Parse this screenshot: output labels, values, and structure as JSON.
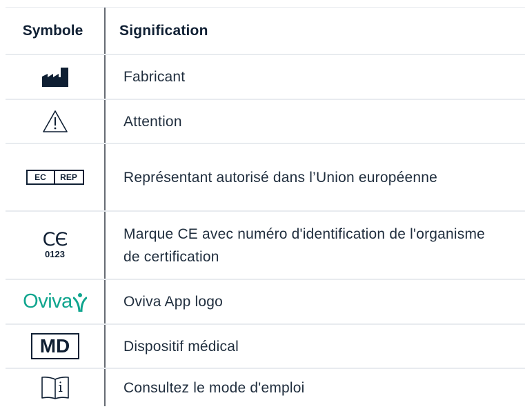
{
  "table": {
    "header": {
      "symbol": "Symbole",
      "meaning": "Signification"
    },
    "rows": [
      {
        "icon": "manufacturer-icon",
        "meaning": "Fabricant"
      },
      {
        "icon": "warning-triangle-icon",
        "meaning": "Attention"
      },
      {
        "icon": "ec-rep-icon",
        "icon_text_1": "EC",
        "icon_text_2": "REP",
        "meaning": "Représentant autorisé dans l’Union européenne"
      },
      {
        "icon": "ce-mark-icon",
        "icon_text": "0123",
        "meaning": "Marque CE avec numéro d'identification de l'organisme de certification"
      },
      {
        "icon": "oviva-logo",
        "icon_text": "Oviva",
        "meaning": "Oviva App logo"
      },
      {
        "icon": "md-icon",
        "icon_text": "MD",
        "meaning": "Dispositif médical"
      },
      {
        "icon": "instructions-book-icon",
        "icon_text": "i",
        "meaning": "Consultez le mode d'emploi"
      }
    ]
  },
  "colors": {
    "text": "#1f2d3d",
    "divider": "#e8ebef",
    "column_divider": "#666b73",
    "oviva_green": "#10a58e"
  }
}
